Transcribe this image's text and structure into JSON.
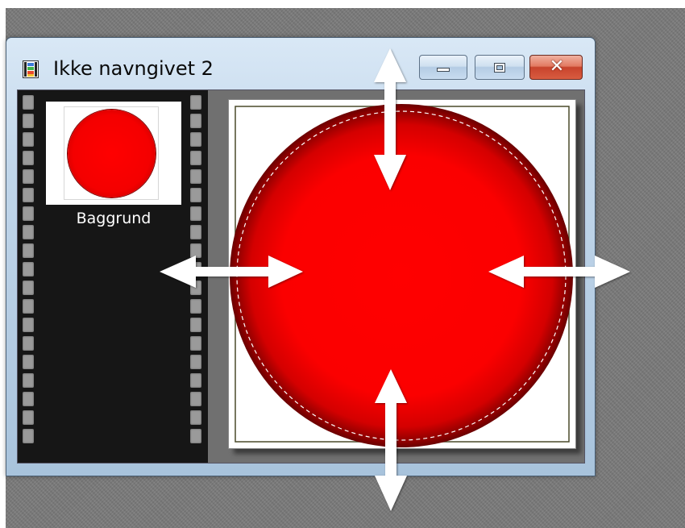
{
  "window": {
    "title": "Ikke navngivet 2",
    "icon": "filmstrip-app-icon"
  },
  "controls": {
    "minimize_icon": "minimize-icon",
    "maximize_icon": "restore-icon",
    "close_icon": "close-icon",
    "close_glyph": "✕"
  },
  "filmstrip": {
    "layers": [
      {
        "label": "Baggrund"
      }
    ]
  },
  "canvas": {
    "shape": "circle",
    "fill_color": "#ff0000",
    "edge_color": "#7a0000",
    "background_color": "#ffffff"
  },
  "overlay": {
    "arrow_icons": [
      "double-arrow-vertical-icon",
      "double-arrow-horizontal-icon"
    ],
    "arrow_color": "#ffffff"
  }
}
